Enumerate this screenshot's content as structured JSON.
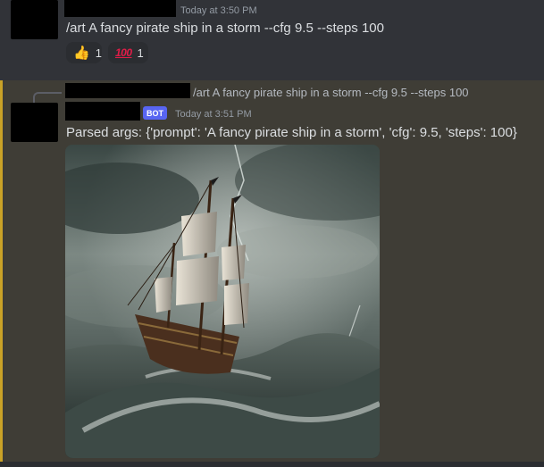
{
  "message1": {
    "timestamp": "Today at 3:50 PM",
    "content": "/art A fancy pirate ship in a storm --cfg 9.5 --steps 100",
    "reactions": [
      {
        "emoji": "thumbs-up",
        "glyph": "👍",
        "count": "1"
      },
      {
        "emoji": "hundred-points",
        "glyph": "100",
        "count": "1"
      }
    ]
  },
  "message2": {
    "reply_text": "/art A fancy pirate ship in a storm --cfg 9.5 --steps 100",
    "bot_tag": "BOT",
    "timestamp": "Today at 3:51 PM",
    "content": "Parsed args: {'prompt': 'A fancy pirate ship in a storm', 'cfg': 9.5, 'steps': 100}",
    "image": {
      "subject": "pirate-ship-in-storm"
    }
  },
  "colors": {
    "background": "#313338",
    "mention_background": "#3f3d36",
    "mention_bar": "#c9a227",
    "bot_tag": "#5865f2",
    "timestamp": "#949ba4"
  }
}
